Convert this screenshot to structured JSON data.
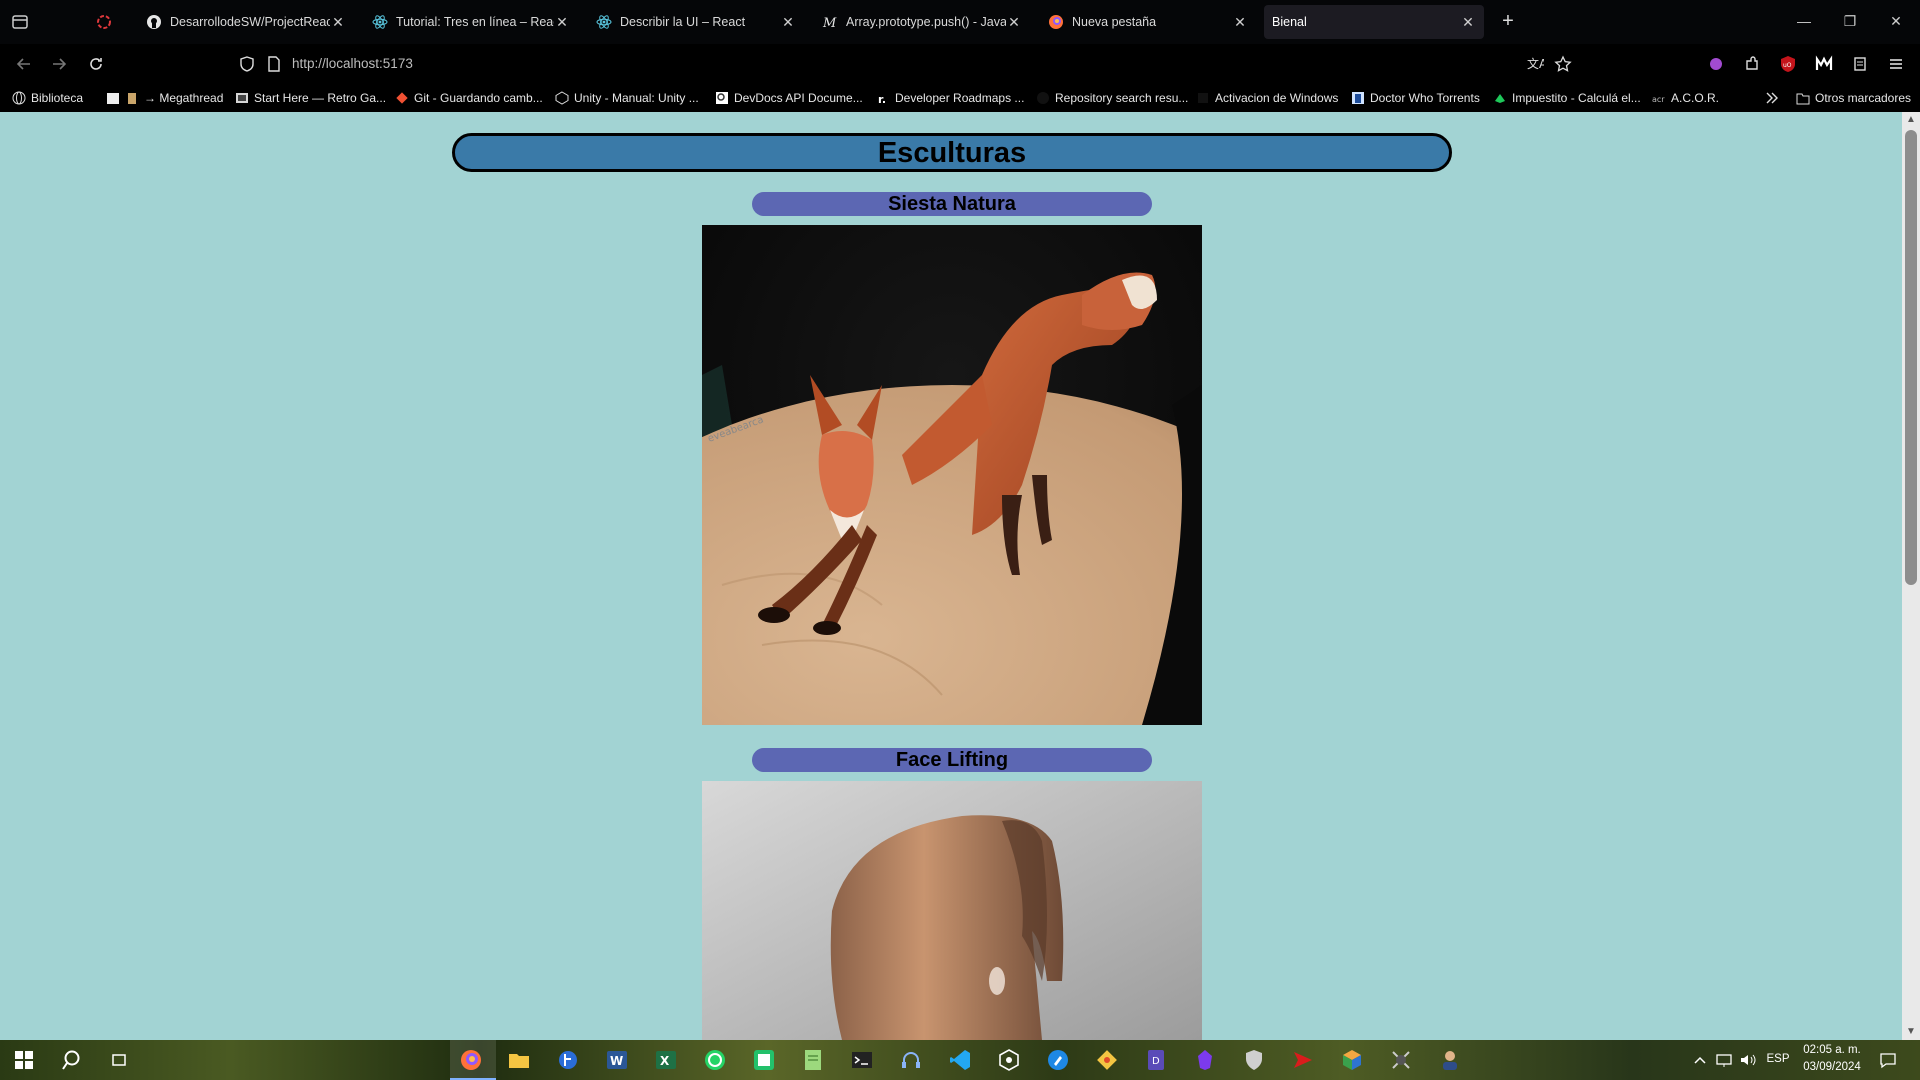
{
  "tabs": [
    {
      "title": "DesarrollodeSW/ProjectReact/B",
      "icon": "github-icon"
    },
    {
      "title": "Tutorial: Tres en línea – React",
      "icon": "react-icon"
    },
    {
      "title": "Describir la UI – React",
      "icon": "react-icon"
    },
    {
      "title": "Array.prototype.push() - JavaSc",
      "icon": "mdn-icon"
    },
    {
      "title": "Nueva pestaña",
      "icon": "firefox-icon"
    },
    {
      "title": "Bienal",
      "icon": "page-icon",
      "active": true
    }
  ],
  "nav": {
    "url": "http://localhost:5173"
  },
  "bookmarks": [
    {
      "label": "Biblioteca"
    },
    {
      "label": "→ Megathread"
    },
    {
      "label": "Start Here — Retro Ga..."
    },
    {
      "label": "Git - Guardando camb..."
    },
    {
      "label": "Unity - Manual: Unity ..."
    },
    {
      "label": "DevDocs API Docume..."
    },
    {
      "label": "Developer Roadmaps ..."
    },
    {
      "label": "Repository search resu..."
    },
    {
      "label": "Activacion de Windows"
    },
    {
      "label": "Doctor Who Torrents"
    },
    {
      "label": "Impuestito - Calculá el..."
    },
    {
      "label": "A.C.O.R."
    },
    {
      "label": "Otros marcadores"
    }
  ],
  "page": {
    "title": "Esculturas",
    "cards": [
      {
        "title": "Siesta Natura",
        "image": "fox-sculpture"
      },
      {
        "title": "Face Lifting",
        "image": "abstract-sculpture"
      }
    ]
  },
  "taskbar": {
    "language": "ESP",
    "time": "02:05 a. m.",
    "date": "03/09/2024"
  },
  "colors": {
    "page_bg": "#a2d3d3",
    "title_bg": "#3a7aa8",
    "card_title_bg": "#5c67b3"
  }
}
